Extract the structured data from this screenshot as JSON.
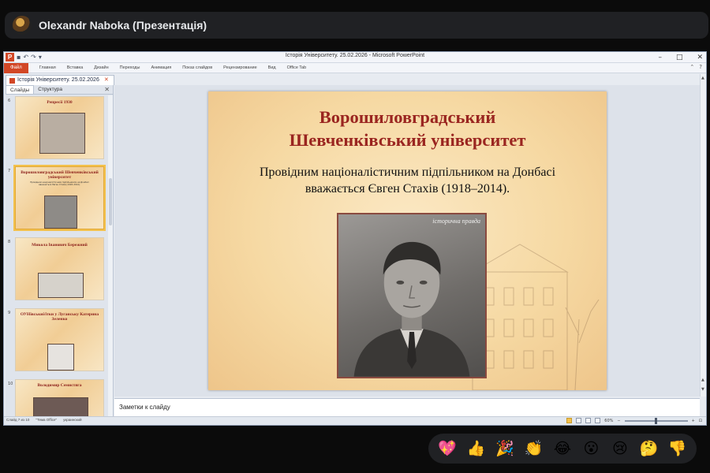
{
  "meet": {
    "presenter_name": "Olexandr Naboka (Презентація)"
  },
  "window": {
    "title": "Історія Університету. 25.02.2026 - Microsoft PowerPoint",
    "app_icon": "P",
    "controls": [
      "–",
      "□",
      "✕"
    ]
  },
  "ribbon": {
    "file_tab": "Файл",
    "tabs": [
      "Главная",
      "Вставка",
      "Дизайн",
      "Переходы",
      "Анимация",
      "Показ слайдов",
      "Рецензирование",
      "Вид",
      "Office Tab"
    ]
  },
  "doc_tab": {
    "label": "Історія Університету. 25.02.2026"
  },
  "left_pane": {
    "tabs": [
      "Слайды",
      "Структура"
    ],
    "thumbnails": [
      {
        "number": "6",
        "title": "Репресії 1930"
      },
      {
        "number": "7",
        "title": "Ворошиловградський Шевченківський університет",
        "subtitle": "Провідним націоналістичним підпільником на Донбасі вважається Євген Стахів (1918–2014)."
      },
      {
        "number": "8",
        "title": "Микола Іванович Бережний"
      },
      {
        "number": "9",
        "title": "ОУНівськиі/ітки у Луганську Катерина Зеленко"
      },
      {
        "number": "10",
        "title": "Володимир Семистяга"
      }
    ]
  },
  "slide": {
    "title_line1": "Ворошиловградський",
    "title_line2": "Шевченківський університет",
    "body_line1": "Провідним націоналістичним підпільником на Донбасі",
    "body_line2": "вважається Євген Стахів (1918–2014).",
    "portrait_caption": "історична правда"
  },
  "notes": {
    "placeholder": "Заметки к слайду"
  },
  "statusbar": {
    "slide_info": "Слайд 7 из 10",
    "theme": "\"Тема Office\"",
    "language": "украинский",
    "zoom": "60%"
  },
  "reactions": [
    {
      "name": "heart",
      "glyph": "💖"
    },
    {
      "name": "thumbs-up",
      "glyph": "👍"
    },
    {
      "name": "party",
      "glyph": "🎉"
    },
    {
      "name": "clap",
      "glyph": "👏"
    },
    {
      "name": "laugh",
      "glyph": "😂"
    },
    {
      "name": "surprised",
      "glyph": "😮"
    },
    {
      "name": "sad",
      "glyph": "😢"
    },
    {
      "name": "thinking",
      "glyph": "🤔"
    },
    {
      "name": "thumbs-down",
      "glyph": "👎"
    }
  ]
}
